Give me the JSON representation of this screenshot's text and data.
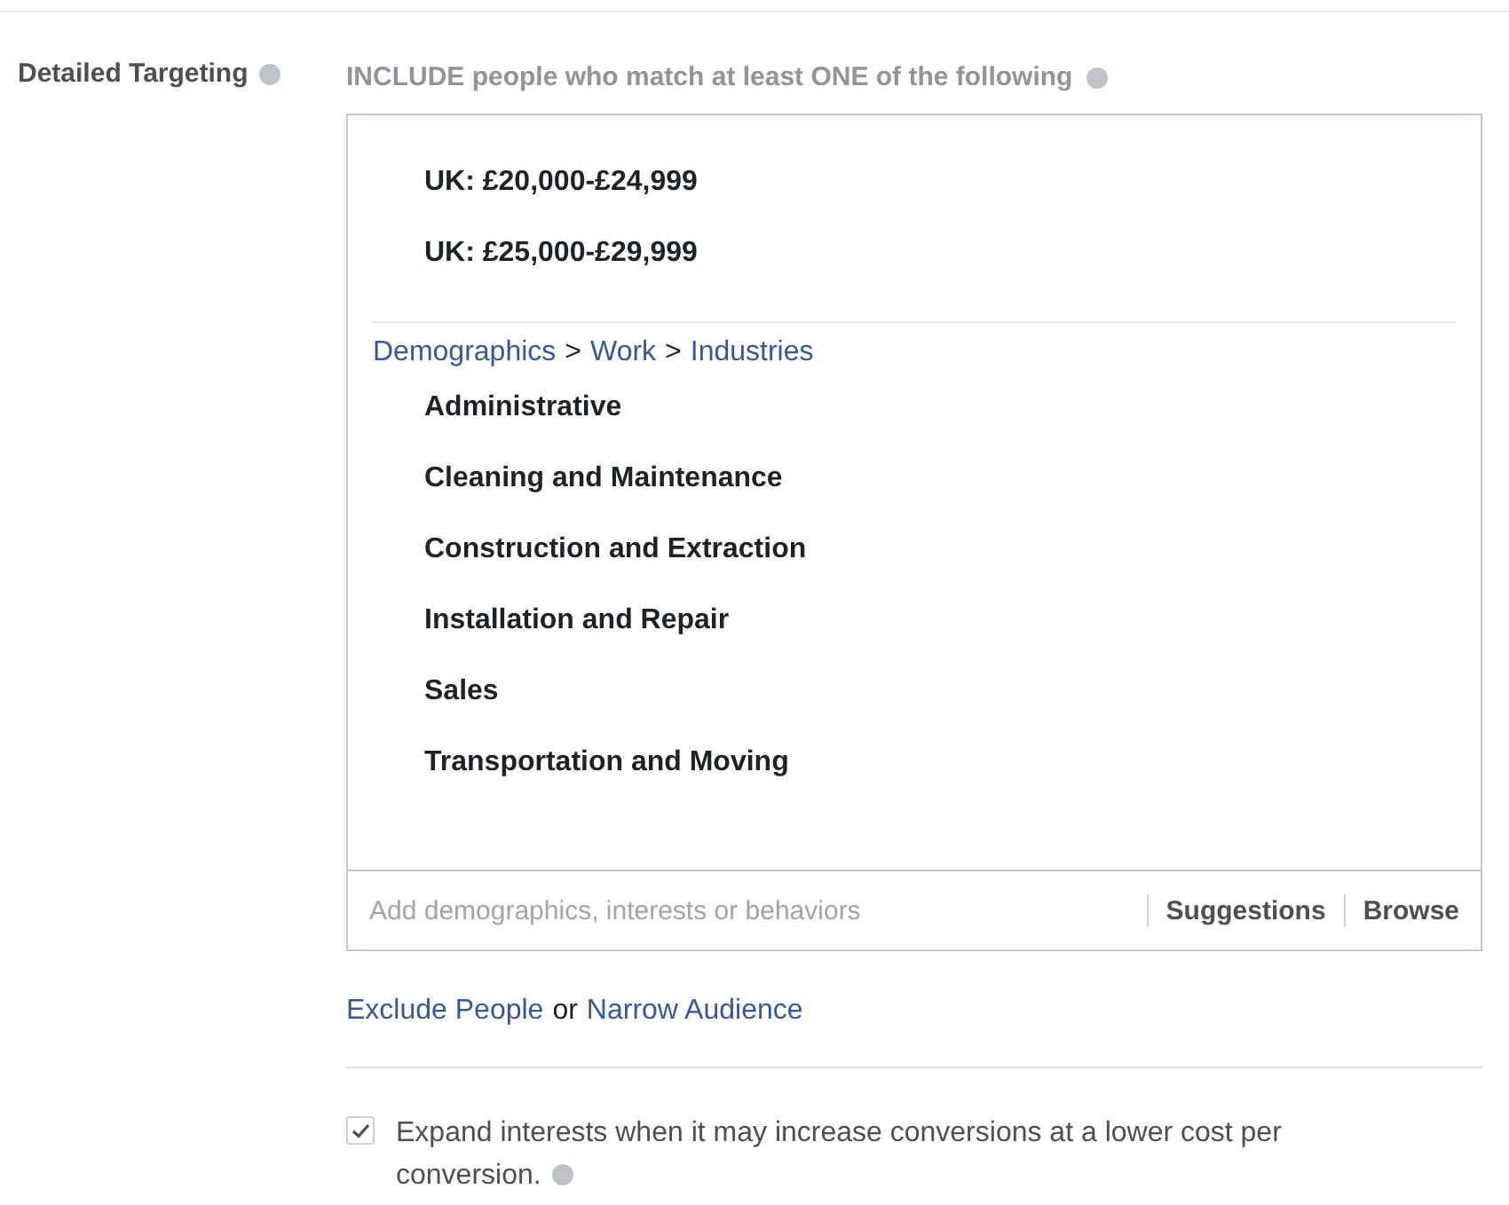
{
  "label": "Detailed Targeting",
  "heading": "INCLUDE people who match at least ONE of the following",
  "groups": [
    {
      "items": [
        "UK: £20,000-£24,999",
        "UK: £25,000-£29,999"
      ]
    },
    {
      "path": [
        {
          "kind": "link",
          "text": "Demographics"
        },
        {
          "kind": "sep",
          "text": ">"
        },
        {
          "kind": "link",
          "text": "Work"
        },
        {
          "kind": "sep",
          "text": ">"
        },
        {
          "kind": "link",
          "text": "Industries"
        }
      ],
      "items": [
        "Administrative",
        "Cleaning and Maintenance",
        "Construction and Extraction",
        "Installation and Repair",
        "Sales",
        "Transportation and Moving"
      ]
    }
  ],
  "search": {
    "placeholder": "Add demographics, interests or behaviors"
  },
  "actions": [
    "Suggestions",
    "Browse"
  ],
  "links": [
    {
      "kind": "link",
      "text": "Exclude People"
    },
    {
      "kind": "text",
      "text": "or"
    },
    {
      "kind": "link",
      "text": "Narrow Audience"
    }
  ],
  "expand": {
    "checked": true,
    "text": "Expand interests when it may increase conversions at a lower cost per conversion."
  }
}
